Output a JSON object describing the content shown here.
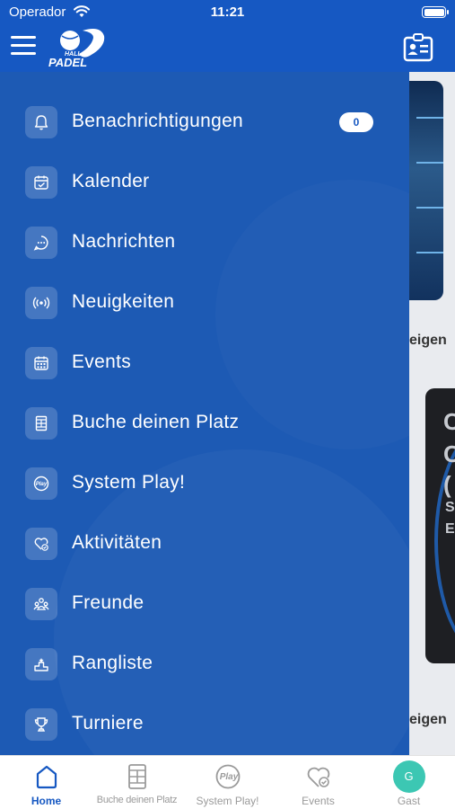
{
  "status_bar": {
    "carrier": "Operador",
    "time": "11:21",
    "battery_level": 1.0
  },
  "header": {
    "logo_text_top": "HALL OF",
    "logo_text_bottom": "PADEL"
  },
  "background": {
    "text_1": "eigen",
    "text_2": "eigen",
    "card_chars": [
      "C",
      "C",
      "(",
      "S",
      "E"
    ]
  },
  "menu": {
    "items": [
      {
        "label": "Benachrichtigungen",
        "icon": "bell-icon",
        "badge": "0"
      },
      {
        "label": "Kalender",
        "icon": "calendar-check-icon"
      },
      {
        "label": "Nachrichten",
        "icon": "chat-bubble-icon"
      },
      {
        "label": "Neuigkeiten",
        "icon": "broadcast-icon"
      },
      {
        "label": "Events",
        "icon": "calendar-grid-icon"
      },
      {
        "label": "Buche deinen Platz",
        "icon": "court-icon"
      },
      {
        "label": "System Play!",
        "icon": "play-logo-icon"
      },
      {
        "label": "Aktivitäten",
        "icon": "heart-check-icon"
      },
      {
        "label": "Freunde",
        "icon": "group-icon"
      },
      {
        "label": "Rangliste",
        "icon": "podium-icon"
      },
      {
        "label": "Turniere",
        "icon": "trophy-icon"
      }
    ]
  },
  "tabbar": {
    "tabs": [
      {
        "label": "Home",
        "icon": "home-icon",
        "active": true
      },
      {
        "label": "Buche deinen Platz",
        "icon": "court-icon"
      },
      {
        "label": "System Play!",
        "icon": "play-logo-icon"
      },
      {
        "label": "Events",
        "icon": "heart-check-icon"
      },
      {
        "label": "Gast",
        "icon": "avatar",
        "avatar_initial": "G"
      }
    ]
  },
  "colors": {
    "brand": "#1658c2",
    "drawer": "#1d5ab4",
    "avatar": "#3cc7b3"
  }
}
